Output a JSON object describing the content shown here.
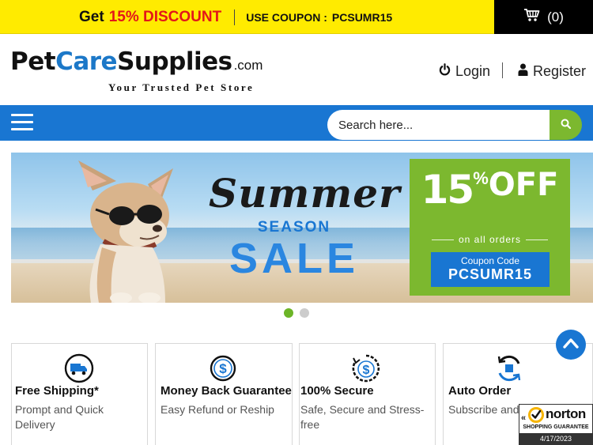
{
  "promo": {
    "get": "Get",
    "discount": "15% DISCOUNT",
    "coupon_label": "USE COUPON :",
    "coupon_code": "PCSUMR15",
    "color_bg": "#ffeb00",
    "color_discount": "#e3161a"
  },
  "cart": {
    "icon": "cart-icon",
    "count": "(0)"
  },
  "logo": {
    "pet": "Pet",
    "care": "Care",
    "supplies": "Supplies",
    "com": ".com",
    "tagline": "Your Trusted Pet Store"
  },
  "auth": {
    "login_icon": "power-icon",
    "login": "Login",
    "register_icon": "user-icon",
    "register": "Register"
  },
  "nav": {
    "menu_icon": "hamburger-menu-icon",
    "color": "#1976d2"
  },
  "search": {
    "placeholder": "Search here...",
    "button_icon": "search-icon",
    "button_color": "#7cb82f"
  },
  "banner": {
    "summer": "Summer",
    "season": "SEASON",
    "sale": "SALE",
    "offer_number": "15",
    "offer_percent": "%",
    "offer_off": "OFF",
    "offer_sub": "on all orders",
    "coupon_label": "Coupon Code",
    "coupon_code": "PCSUMR15",
    "active_slide": 1,
    "slide_count": 2
  },
  "features": [
    {
      "icon": "delivery-truck-icon",
      "title": "Free Shipping*",
      "desc": "Prompt and Quick Delivery"
    },
    {
      "icon": "dollar-coin-icon",
      "title": "Money Back Guarantee",
      "desc": "Easy Refund or Reship"
    },
    {
      "icon": "secure-dollar-icon",
      "title": "100% Secure",
      "desc": "Safe, Secure and Stress-free"
    },
    {
      "icon": "auto-order-refresh-icon",
      "title": "Auto Order",
      "desc": "Subscribe and"
    }
  ],
  "back_to_top": {
    "icon": "chevron-up-icon"
  },
  "norton": {
    "name": "norton",
    "sub": "SHOPPING GUARANTEE",
    "date": "4/17/2023"
  }
}
